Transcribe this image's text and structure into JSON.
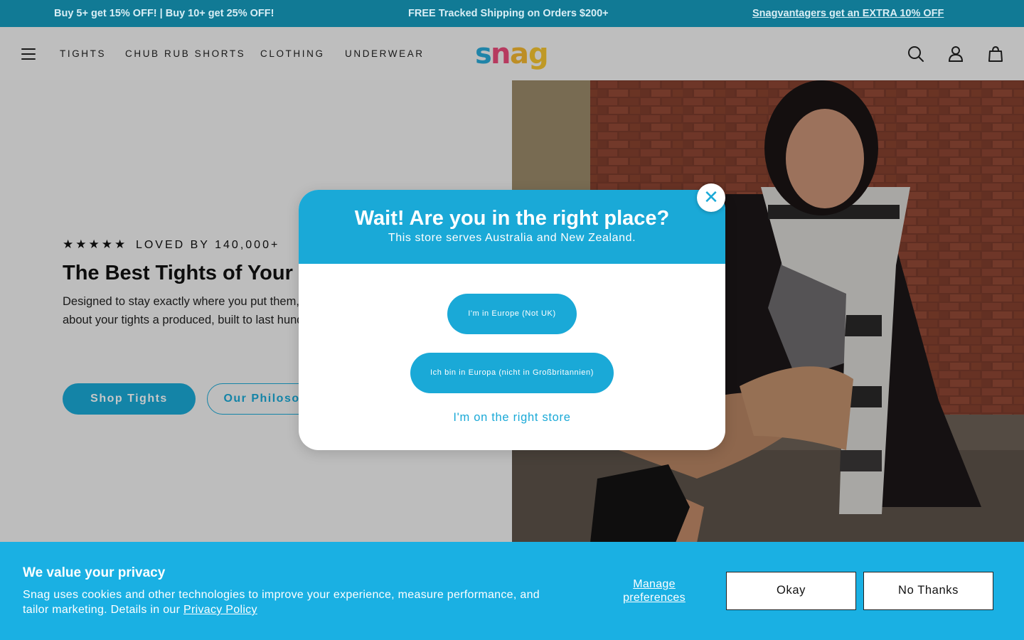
{
  "announcement": {
    "msg1": "Buy 5+ get 15% OFF! | Buy 10+ get 25% OFF!",
    "msg2": "FREE Tracked Shipping on Orders $200+",
    "msg3": "Snagvantagers get an EXTRA 10% OFF"
  },
  "header": {
    "nav": [
      "TIGHTS",
      "CHUB RUB SHORTS",
      "CLOTHING",
      "UNDERWEAR"
    ],
    "logo_text": "snag",
    "icons": [
      "menu-icon",
      "search-icon",
      "account-icon",
      "bag-icon"
    ]
  },
  "hero": {
    "stars": "★★★★★",
    "loved": "LOVED BY 140,000+",
    "title": "The Best Tights of Your L",
    "description": "Designed to stay exactly where you put them, no digging in, no thinking about your tights a produced, built to last hundreds of washes, a bodies.",
    "shop_button": "Shop Tights",
    "philosophy_button": "Our Philosophy"
  },
  "modal": {
    "title": "Wait! Are you in the right place?",
    "subtitle": "This store serves Australia and New Zealand.",
    "button_europe": "I'm in Europe (Not UK)",
    "button_europe_de": "Ich bin in Europa (nicht in Großbritannien)",
    "right_store_link": "I'm on the right store",
    "close_symbol": "✕"
  },
  "cookie": {
    "title": "We value your privacy",
    "text": "Snag uses cookies and other technologies to improve your experience, measure performance, and tailor marketing. Details in our",
    "privacy_link": "Privacy Policy",
    "manage": "Manage preferences",
    "okay": "Okay",
    "no_thanks": "No Thanks"
  },
  "colors": {
    "brand_blue": "#1aa9d7",
    "announcement_bg": "#117a95",
    "cookie_bg": "#1ab0e3"
  }
}
